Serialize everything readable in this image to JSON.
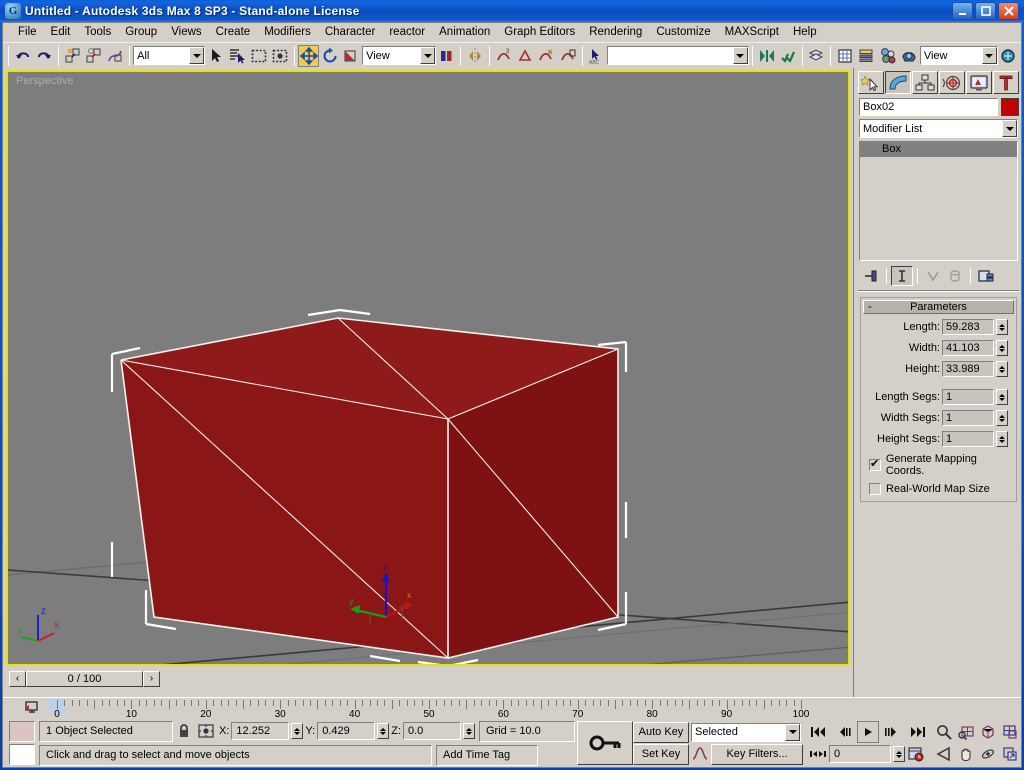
{
  "window": {
    "title": "Untitled - Autodesk 3ds Max 8 SP3  - Stand-alone License",
    "app_icon": "max-logo-icon",
    "minimize": "_",
    "maximize": "❐",
    "close": "✕"
  },
  "menu": [
    {
      "label": "File",
      "accel": "F"
    },
    {
      "label": "Edit",
      "accel": "E"
    },
    {
      "label": "Tools",
      "accel": "T"
    },
    {
      "label": "Group",
      "accel": "G"
    },
    {
      "label": "Views",
      "accel": "V"
    },
    {
      "label": "Create",
      "accel": "C"
    },
    {
      "label": "Modifiers",
      "accel": "d"
    },
    {
      "label": "Character",
      "accel": "h"
    },
    {
      "label": "reactor",
      "accel": ""
    },
    {
      "label": "Animation",
      "accel": "A"
    },
    {
      "label": "Graph Editors",
      "accel": "d"
    },
    {
      "label": "Rendering",
      "accel": "R"
    },
    {
      "label": "Customize",
      "accel": "u"
    },
    {
      "label": "MAXScript",
      "accel": "M"
    },
    {
      "label": "Help",
      "accel": "H"
    }
  ],
  "toolbar": {
    "undo": "undo-icon",
    "redo": "redo-icon",
    "select_link": "select-and-link-icon",
    "unlink": "unlink-selection-icon",
    "bind_space_warp": "bind-to-space-warp-icon",
    "selection_filter_value": "All",
    "select_object": "select-object-icon",
    "select_by_name": "select-by-name-icon",
    "rect_select_region": "rectangular-selection-region-icon",
    "window_crossing": "window-crossing-icon",
    "select_move": "select-and-move-icon",
    "select_rotate": "select-and-rotate-icon",
    "select_scale": "select-and-uniform-scale-icon",
    "ref_coord_value": "View",
    "use_pivot_center": "use-pivot-point-center-icon",
    "mirror": "mirror-icon",
    "align": "align-icon",
    "normal_align": "normal-align-icon",
    "place_highlight": "place-highlight-icon",
    "align_camera": "align-camera-icon",
    "named_selection_value": "",
    "mirror_tool": "mirror-selected-objects-icon",
    "array_tool": "array-icon",
    "layer_manager": "layer-manager-icon",
    "curve_editor": "curve-editor-icon",
    "schematic_view": "schematic-view-icon",
    "material_editor": "material-editor-icon",
    "render_scene": "render-scene-dialog-icon",
    "render_view_value": "View",
    "quick_render": "quick-render-icon"
  },
  "viewport": {
    "label": "Perspective",
    "background_color": "#7d7d7d",
    "border_color": "#e8e400",
    "object_color": "#8b1a1a",
    "object_edge_color": "#ffffff",
    "axis_labels": {
      "x": "x",
      "y": "y",
      "z": "z"
    },
    "world_axis": {
      "x": "x",
      "y": "y",
      "z": "z"
    }
  },
  "time_slider": {
    "prev_label": "‹",
    "value": "0 / 100",
    "next_label": "›"
  },
  "command_panel": {
    "tabs": [
      {
        "name": "create-tab",
        "icon": "star-arrow-icon",
        "selected": false
      },
      {
        "name": "modify-tab",
        "icon": "bent-arc-icon",
        "selected": true
      },
      {
        "name": "hierarchy-tab",
        "icon": "hierarchy-tree-icon",
        "selected": false
      },
      {
        "name": "motion-tab",
        "icon": "wheel-motion-icon",
        "selected": false
      },
      {
        "name": "display-tab",
        "icon": "monitor-display-icon",
        "selected": false
      },
      {
        "name": "utilities-tab",
        "icon": "hammer-icon",
        "selected": false
      }
    ],
    "object_name": "Box02",
    "object_color": "#c30000",
    "modifier_list_label": "Modifier List",
    "stack": [
      {
        "label": "Box",
        "selected": true
      }
    ],
    "stack_buttons": [
      {
        "name": "pin-stack-button",
        "icon": "pin-icon"
      },
      {
        "name": "show-end-result-button",
        "icon": "show-end-result-icon"
      },
      {
        "name": "make-unique-button",
        "icon": "make-unique-icon"
      },
      {
        "name": "remove-modifier-button",
        "icon": "trash-icon"
      },
      {
        "name": "configure-modifier-sets-button",
        "icon": "configure-sets-icon"
      }
    ],
    "parameters": {
      "title": "Parameters",
      "collapse_glyph": "-",
      "fields": [
        {
          "label": "Length:",
          "value": "59.283"
        },
        {
          "label": "Width:",
          "value": "41.103"
        },
        {
          "label": "Height:",
          "value": "33.989"
        }
      ],
      "segs": [
        {
          "label": "Length Segs:",
          "value": "1"
        },
        {
          "label": "Width Segs:",
          "value": "1"
        },
        {
          "label": "Height Segs:",
          "value": "1"
        }
      ],
      "checkboxes": [
        {
          "label": "Generate Mapping Coords.",
          "checked": true
        },
        {
          "label": "Real-World Map Size",
          "checked": false
        }
      ]
    }
  },
  "timeline": {
    "ticks": [
      "0",
      "10",
      "20",
      "30",
      "40",
      "50",
      "60",
      "70",
      "80",
      "90",
      "100"
    ],
    "current_frame": "0",
    "track_bar_icon": "track-bar-icon"
  },
  "status_bar": {
    "selection_text": "1 Object Selected",
    "lock_icon": "lock-selection-icon",
    "coord_toggle_icon": "absolute-relative-transform-icon",
    "coords": [
      {
        "label": "X:",
        "value": "12.252"
      },
      {
        "label": "Y:",
        "value": "0.429"
      },
      {
        "label": "Z:",
        "value": "0.0"
      }
    ],
    "grid_text": "Grid = 10.0",
    "prompt_text": "Click and drag to select and move objects",
    "add_time_tag": "Add Time Tag",
    "key_mode_icon": "key-mode-toggle-icon"
  },
  "animation": {
    "auto_key": "Auto Key",
    "set_key": "Set Key",
    "key_filters": "Key Filters...",
    "selection_level": "Selected",
    "curve_icon": "set-key-curve-icon",
    "transport": [
      {
        "name": "go-to-start-button",
        "glyph": "|◀◀"
      },
      {
        "name": "previous-frame-button",
        "glyph": "◀|"
      },
      {
        "name": "play-animation-button",
        "glyph": "▶"
      },
      {
        "name": "next-frame-button",
        "glyph": "|▶"
      },
      {
        "name": "go-to-end-button",
        "glyph": "▶▶|"
      }
    ],
    "key_mode_glyph": "|◀▶|",
    "frame_field": "0",
    "time_config_icon": "time-configuration-icon"
  },
  "viewport_nav": [
    {
      "name": "zoom-button",
      "icon": "magnifier-icon"
    },
    {
      "name": "zoom-all-button",
      "icon": "zoom-all-icon"
    },
    {
      "name": "zoom-extents-button",
      "icon": "zoom-extents-icon"
    },
    {
      "name": "zoom-extents-all-button",
      "icon": "zoom-extents-all-icon"
    },
    {
      "name": "field-of-view-button",
      "icon": "fov-icon"
    },
    {
      "name": "pan-button",
      "icon": "hand-pan-icon"
    },
    {
      "name": "arc-rotate-button",
      "icon": "arc-rotate-icon"
    },
    {
      "name": "maximize-viewport-toggle",
      "icon": "maximize-viewport-icon"
    }
  ]
}
